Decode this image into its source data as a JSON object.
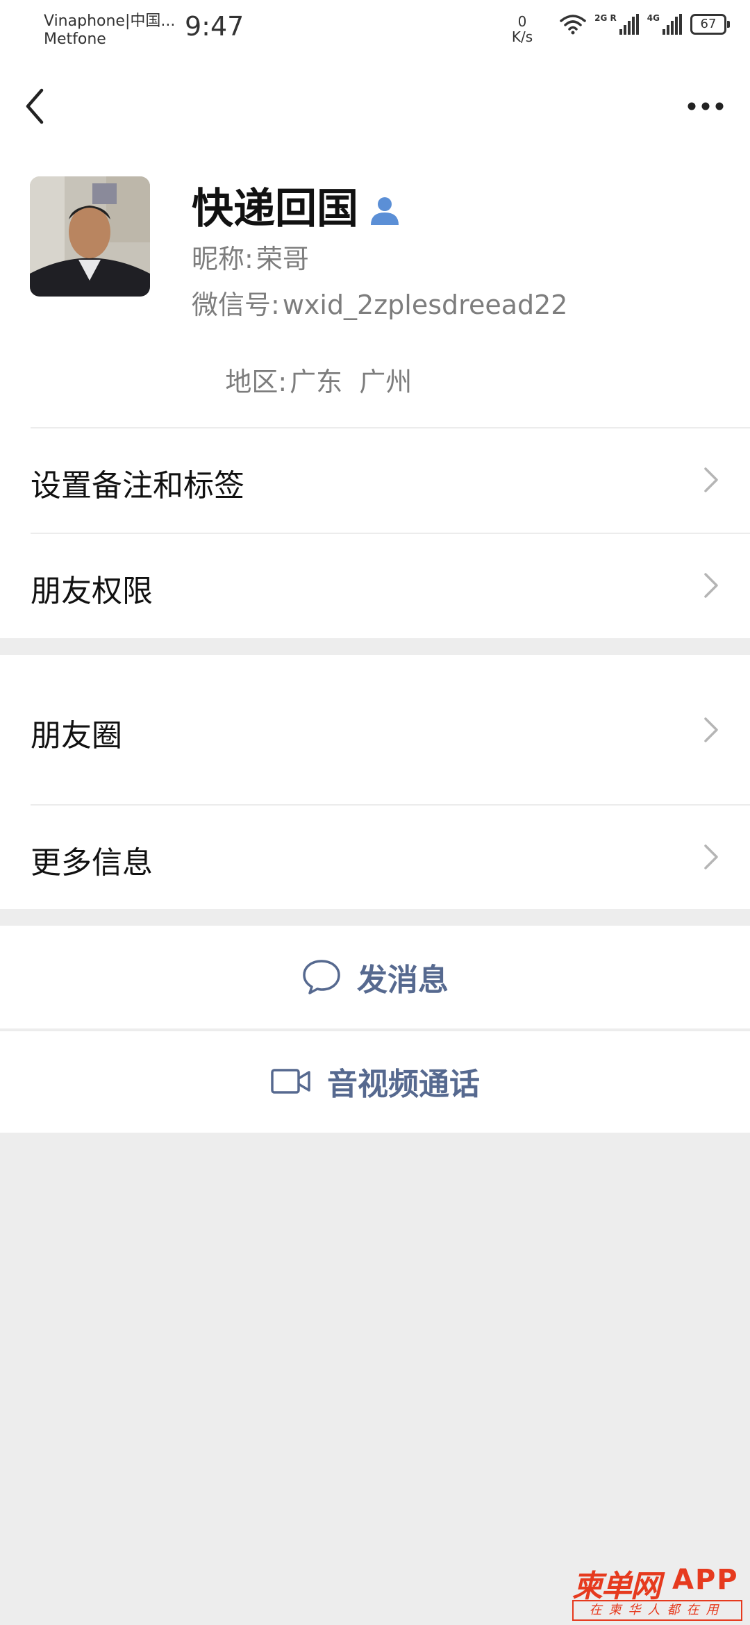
{
  "status_bar": {
    "carrier_line1": "Vinaphone|中国...",
    "carrier_line2": "Metfone",
    "time": "9:47",
    "net_speed_value": "0",
    "net_speed_unit": "K/s",
    "signal1_tag": "2G R",
    "signal2_tag": "4G",
    "battery": "67"
  },
  "navbar": {
    "back_icon": "chevron-left-icon",
    "more_icon": "more-dots-icon"
  },
  "profile": {
    "name": "快递回国",
    "nickname_label": "昵称:",
    "nickname": "荣哥",
    "wechat_id_label": "微信号:",
    "wechat_id": "wxid_2zplesdreead22",
    "region_label": "地区:",
    "region": "广东  广州"
  },
  "menu": {
    "set_remark": "设置备注和标签",
    "friend_permissions": "朋友权限",
    "moments": "朋友圈",
    "more_info": "更多信息"
  },
  "actions": {
    "send_message": "发消息",
    "video_call": "音视频通话"
  },
  "watermark": {
    "title": "柬单网",
    "app": "APP",
    "slogan": "在柬华人都在用"
  }
}
